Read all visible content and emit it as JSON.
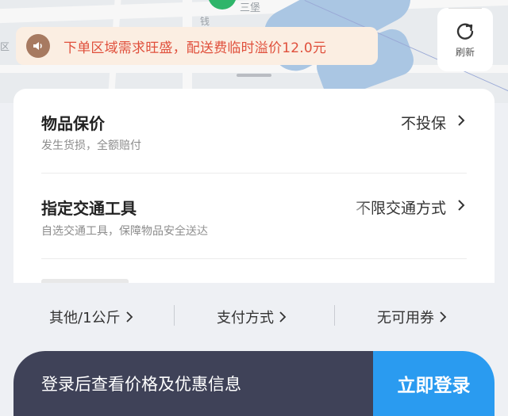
{
  "map": {
    "labels": [
      "三堡",
      "钱",
      "区"
    ]
  },
  "notice": {
    "text": "下单区域需求旺盛，配送费临时溢价12.0元",
    "icon": "speaker-icon"
  },
  "refresh": {
    "label": "刷新",
    "icon": "refresh-icon"
  },
  "options": [
    {
      "title": "物品保价",
      "subtitle": "发生货损，全额赔付",
      "value": "不投保"
    },
    {
      "title": "指定交通工具",
      "subtitle": "自选交通工具，保障物品安全送达",
      "value": "不限交通方式"
    }
  ],
  "footer_options": {
    "other": "其他/1公斤",
    "payment": "支付方式",
    "coupon": "无可用券"
  },
  "bottom_bar": {
    "prompt": "登录后查看价格及优惠信息",
    "login_button": "立即登录"
  },
  "colors": {
    "notice_text": "#e0503c",
    "notice_bg": "#fbeee2",
    "login_button_bg": "#2a9bf0",
    "bottom_bar_bg": "#3f4258"
  }
}
